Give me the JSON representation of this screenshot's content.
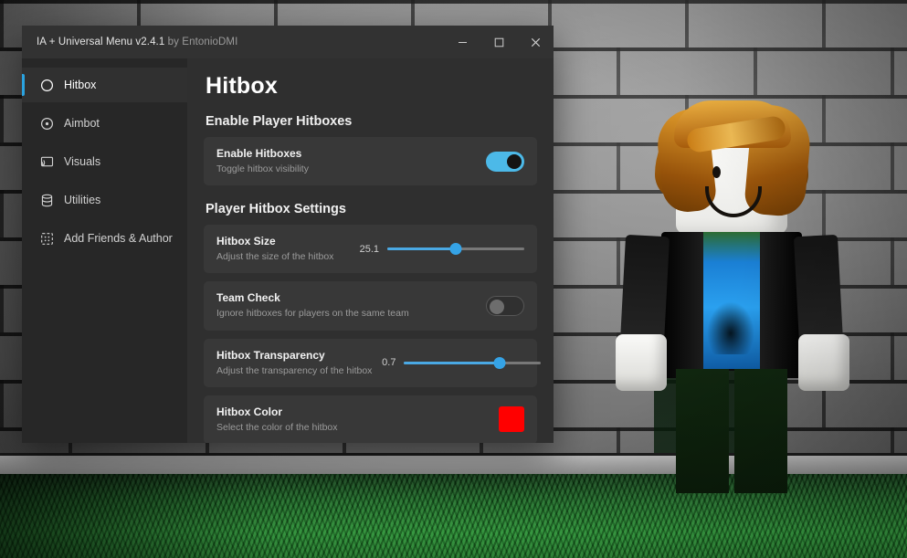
{
  "window": {
    "title_main": "IA + Universal Menu v2.4.1",
    "title_author": "by EntonioDMI",
    "minimize_label": "—",
    "maximize_label": "□",
    "close_label": "✕"
  },
  "sidebar": {
    "items": [
      {
        "label": "Hitbox",
        "icon": "circle-icon",
        "active": true
      },
      {
        "label": "Aimbot",
        "icon": "target-icon",
        "active": false
      },
      {
        "label": "Visuals",
        "icon": "cast-screen-icon",
        "active": false
      },
      {
        "label": "Utilities",
        "icon": "database-icon",
        "active": false
      },
      {
        "label": "Add Friends & Author",
        "icon": "dashed-square-icon",
        "active": false
      }
    ]
  },
  "page": {
    "title": "Hitbox",
    "sections": [
      {
        "heading": "Enable Player Hitboxes"
      },
      {
        "heading": "Player Hitbox Settings"
      }
    ],
    "settings": {
      "enable_hitboxes": {
        "title": "Enable Hitboxes",
        "desc": "Toggle hitbox visibility",
        "state": "on"
      },
      "hitbox_size": {
        "title": "Hitbox Size",
        "desc": "Adjust the size of the hitbox",
        "value": "25.1",
        "percent": 50
      },
      "team_check": {
        "title": "Team Check",
        "desc": "Ignore hitboxes for players on the same team",
        "state": "off"
      },
      "hitbox_transparency": {
        "title": "Hitbox Transparency",
        "desc": "Adjust the transparency of the hitbox",
        "value": "0.7",
        "percent": 70
      },
      "hitbox_color": {
        "title": "Hitbox Color",
        "desc": "Select the color of the hitbox",
        "value": "#FF0000"
      }
    }
  },
  "theme": {
    "accent": "#2aa3e0",
    "toggle_on": "#4cb9e8",
    "slider_fill": "#4aa9e4",
    "window_bg": "#2b2b2b",
    "sidebar_bg": "#272727",
    "content_bg": "#2f2f2f",
    "card_bg": "#383838"
  }
}
